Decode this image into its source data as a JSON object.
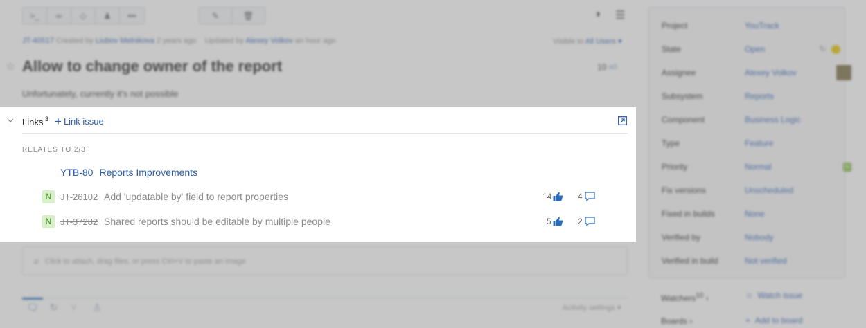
{
  "toolbar": {
    "group1": [
      "terminal-icon",
      "link-icon",
      "tag-icon",
      "user-icon",
      "more-icon"
    ],
    "group2": [
      "pencil-icon",
      "trash-icon"
    ],
    "right": [
      "contrast-icon",
      "menu-icon"
    ]
  },
  "issue": {
    "id": "JT-40517",
    "created_prefix": "Created by",
    "creator": "Liubov Melnikova",
    "created_ago": "2 years ago",
    "updated_prefix": "Updated by",
    "updater": "Alexey Volkov",
    "updated_ago": "an hour ago",
    "visible_prefix": "Visible to",
    "visible_value": "All Users ▾",
    "title": "Allow to change owner of the report",
    "votes": "10",
    "description": "Unfortunately, currently it's not possible"
  },
  "links": {
    "title": "Links",
    "count": "3",
    "add_label": "Link issue",
    "group_label": "RELATES TO 2/3",
    "parent": {
      "id": "YTB-80",
      "summary": "Reports Improvements"
    },
    "items": [
      {
        "priority": "N",
        "id": "JT-26102",
        "summary": "Add 'updatable by' field to report properties",
        "votes": "14",
        "comments": "4"
      },
      {
        "priority": "N",
        "id": "JT-37282",
        "summary": "Shared reports should be editable by multiple people",
        "votes": "5",
        "comments": "2"
      }
    ]
  },
  "attach": {
    "placeholder": "Click to attach, drag files, or press Ctrl+V to paste an image"
  },
  "activity": {
    "settings_label": "Activity settings ▾"
  },
  "fields": [
    {
      "name": "Project",
      "value": "YouTrack"
    },
    {
      "name": "State",
      "value": "Open"
    },
    {
      "name": "Assignee",
      "value": "Alexey Volkov"
    },
    {
      "name": "Subsystem",
      "value": "Reports"
    },
    {
      "name": "Component",
      "value": "Business Logic"
    },
    {
      "name": "Type",
      "value": "Feature"
    },
    {
      "name": "Priority",
      "value": "Normal"
    },
    {
      "name": "Fix versions",
      "value": "Unscheduled"
    },
    {
      "name": "Fixed in builds",
      "value": "None"
    },
    {
      "name": "Verified by",
      "value": "Nobody"
    },
    {
      "name": "Verified in build",
      "value": "Not verified"
    }
  ],
  "sidebar": {
    "watchers_label": "Watchers",
    "watchers_count": "10",
    "watch_label": "Watch issue",
    "boards_label": "Boards",
    "add_board_label": "Add to board",
    "priority_badge": "N"
  },
  "colors": {
    "accent": "#2a5db0",
    "priority_bg": "#d8f0c8",
    "priority_fg": "#3d8a1e",
    "state_badge": "#e6c400"
  }
}
